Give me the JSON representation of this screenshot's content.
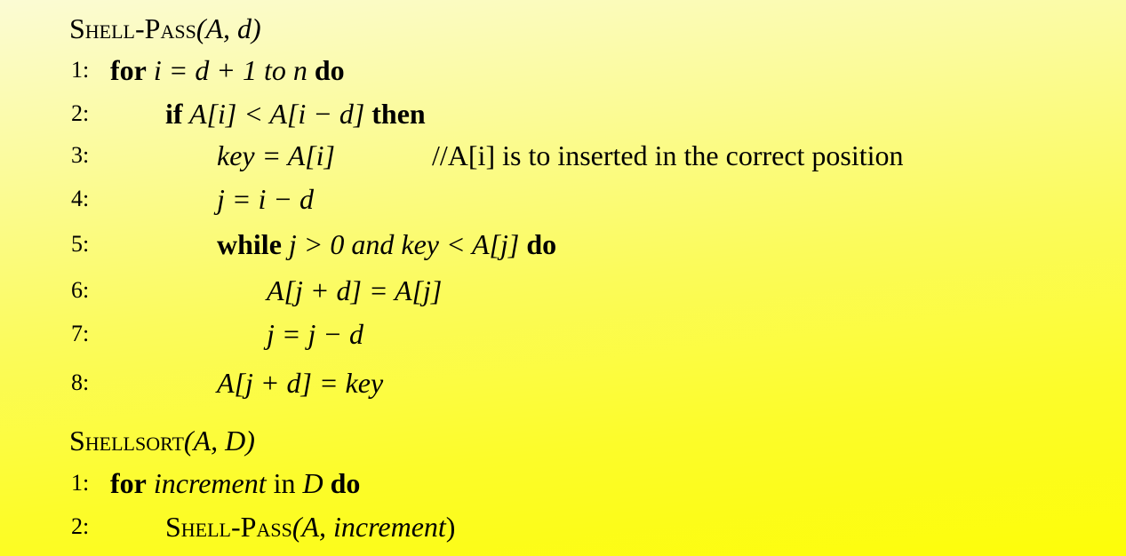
{
  "shell_pass": {
    "title_name": "Shell-Pass",
    "title_args": "(A, d)",
    "lines": [
      {
        "num": "1:",
        "text_1_kw": "for",
        "text_1": " i = d + 1 to n ",
        "text_1_kw2": "do"
      },
      {
        "num": "2:",
        "text_kw": "if",
        "text": " A[i] < A[i − d] ",
        "text_kw2": "then"
      },
      {
        "num": "3:",
        "text": "key = A[i]",
        "comment": "//A[i] is to inserted in the correct position"
      },
      {
        "num": "4:",
        "text": "j = i − d"
      },
      {
        "num": "5:",
        "text_kw": "while",
        "text_a": " j > 0 and ",
        "text_b": "key < A[j] ",
        "text_kw2": "do"
      },
      {
        "num": "6:",
        "text": "A[j + d] = A[j]"
      },
      {
        "num": "7:",
        "text": "j = j − d"
      },
      {
        "num": "8:",
        "text": "A[j + d] = key"
      }
    ]
  },
  "shellsort": {
    "title_name": "Shellsort",
    "title_args": "(A, D)",
    "lines": [
      {
        "num": "1:",
        "text_kw": "for",
        "text_a": " increment",
        "text_b": " in ",
        "text_c": "D ",
        "text_kw2": "do"
      },
      {
        "num": "2:",
        "call_name": "Shell-Pass",
        "call_args_a": "(A, ",
        "call_args_b": "increment",
        "call_args_c": ")"
      }
    ]
  }
}
